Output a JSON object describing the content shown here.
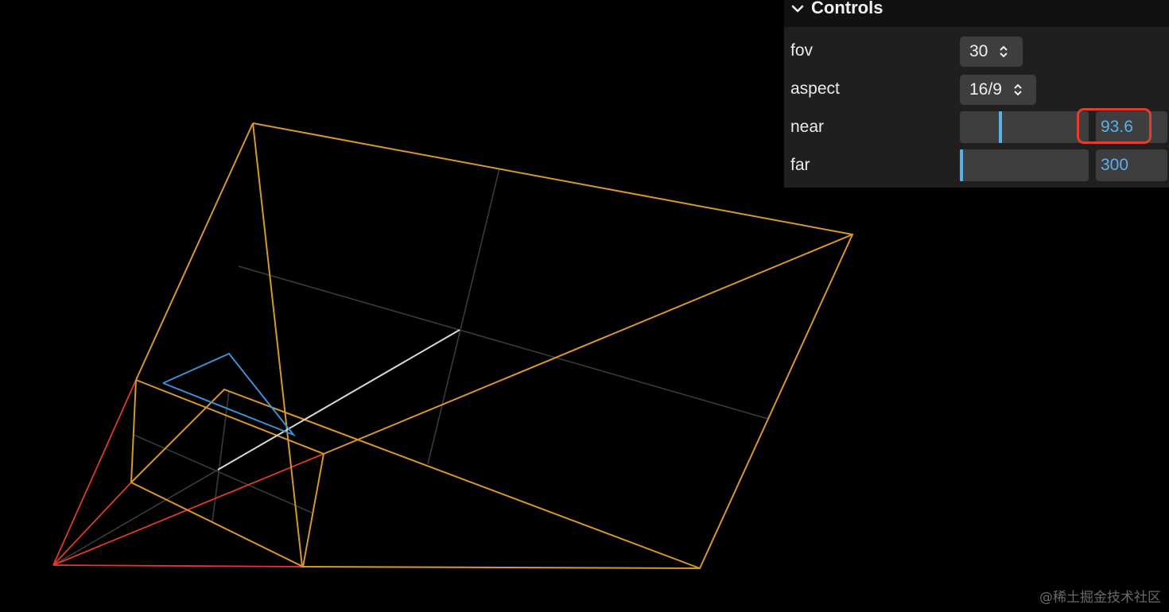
{
  "scene": {
    "colors": {
      "frustum": "#d8962c",
      "grid": "#3a3a3a",
      "camera_cone": "#e03a2a",
      "up_triangle": "#3b8fd6",
      "axis": "#d8d8d8"
    }
  },
  "controls": {
    "title": "Controls",
    "fov": {
      "label": "fov",
      "value": "30"
    },
    "aspect": {
      "label": "aspect",
      "value": "16/9"
    },
    "near": {
      "label": "near",
      "value": "93.6",
      "slider_fraction": 0.31
    },
    "far": {
      "label": "far",
      "value": "300",
      "slider_fraction": 0.0
    },
    "accent_color": "#5ab0e8",
    "highlight_color": "#e0402a"
  },
  "watermark": "@稀土掘金技术社区"
}
